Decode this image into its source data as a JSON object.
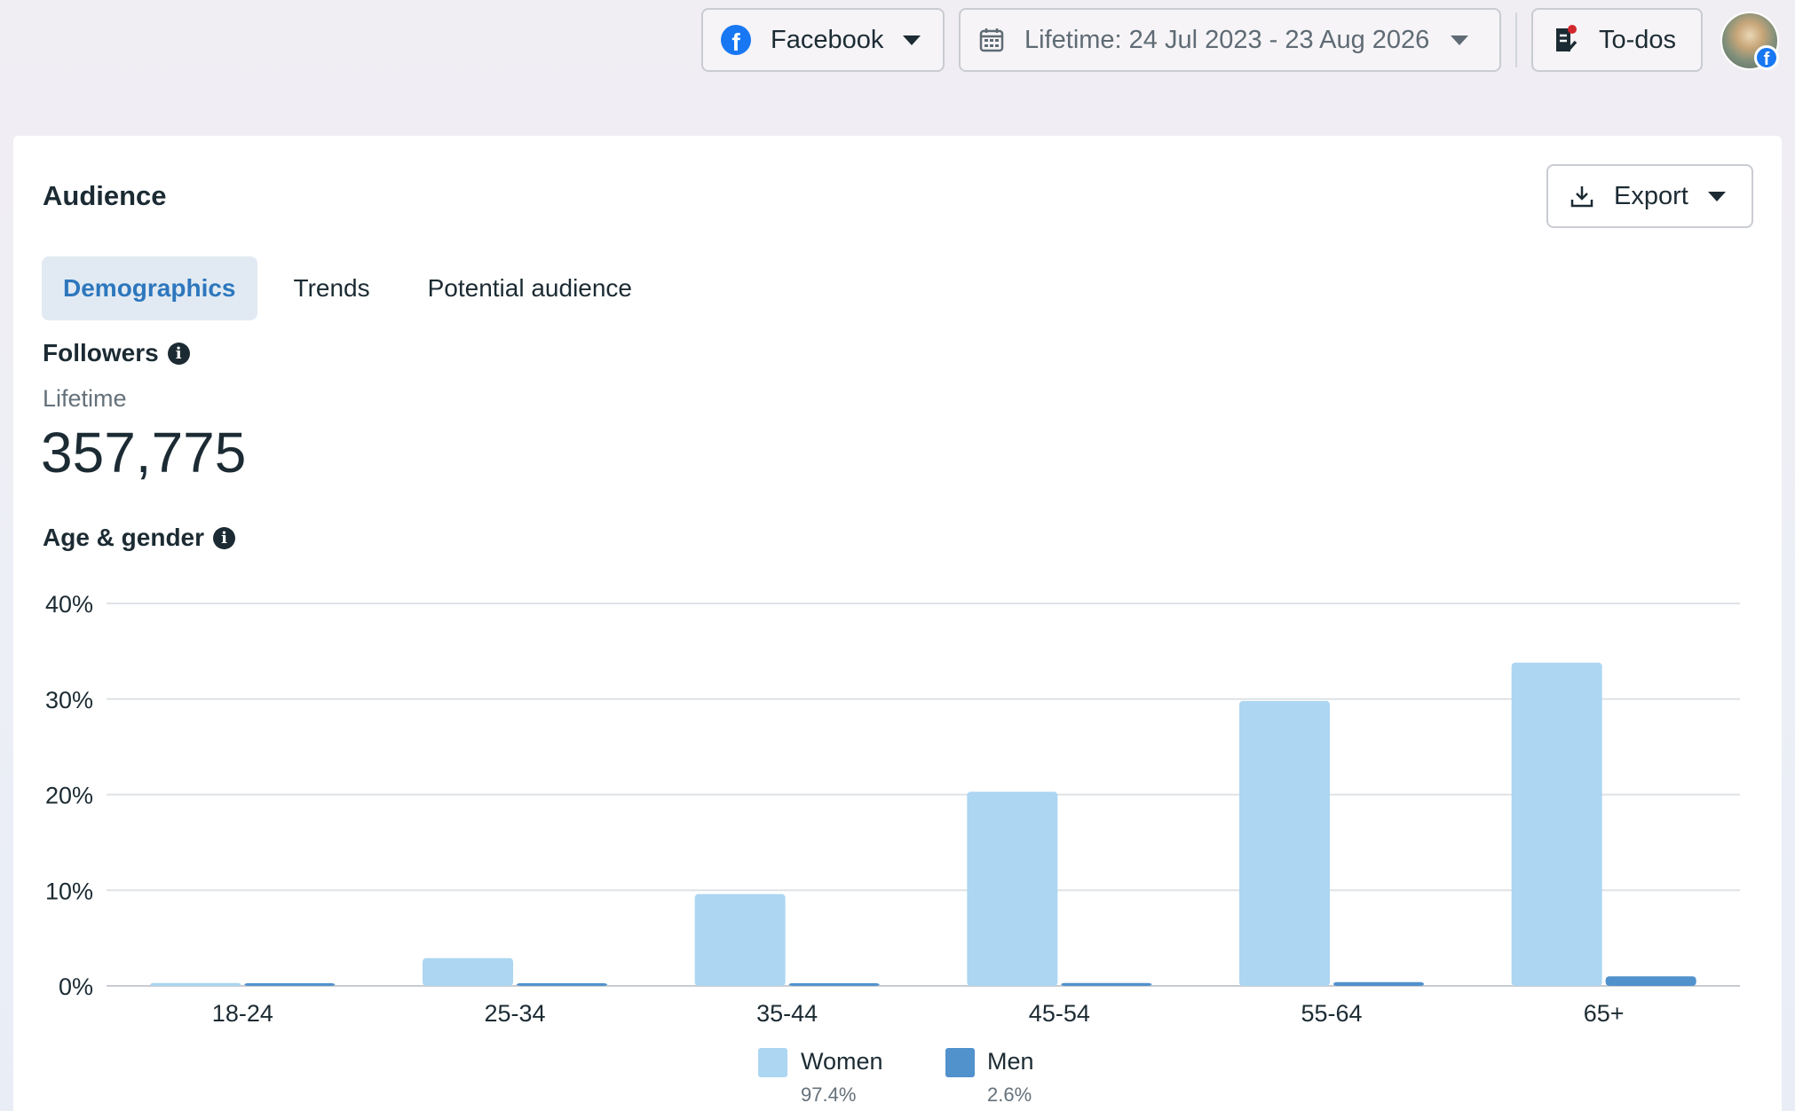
{
  "topbar": {
    "platform_label": "Facebook",
    "date_label": "Lifetime: 24 Jul 2023 - 23 Aug 2026",
    "todos_label": "To-dos"
  },
  "card": {
    "title": "Audience",
    "export_label": "Export",
    "tabs": [
      {
        "label": "Demographics",
        "active": true
      },
      {
        "label": "Trends",
        "active": false
      },
      {
        "label": "Potential audience",
        "active": false
      }
    ]
  },
  "followers": {
    "title": "Followers",
    "subtitle": "Lifetime",
    "count": "357,775"
  },
  "age_gender": {
    "title": "Age & gender"
  },
  "colors": {
    "women": "#acd6f2",
    "men": "#5191cc",
    "accent": "#2d77bd",
    "grid": "#dfe2e6"
  },
  "chart_data": {
    "type": "bar",
    "categories": [
      "18-24",
      "25-34",
      "35-44",
      "45-54",
      "55-64",
      "65+"
    ],
    "series": [
      {
        "name": "Women",
        "values": [
          0.3,
          2.9,
          9.6,
          20.3,
          29.8,
          33.8
        ],
        "share": "97.4%"
      },
      {
        "name": "Men",
        "values": [
          0.1,
          0.1,
          0.2,
          0.3,
          0.4,
          1.0
        ],
        "share": "2.6%"
      }
    ],
    "yticks": [
      "0%",
      "10%",
      "20%",
      "30%",
      "40%"
    ],
    "ylim": [
      0,
      40
    ],
    "grid": true,
    "legend_position": "bottom-center"
  }
}
